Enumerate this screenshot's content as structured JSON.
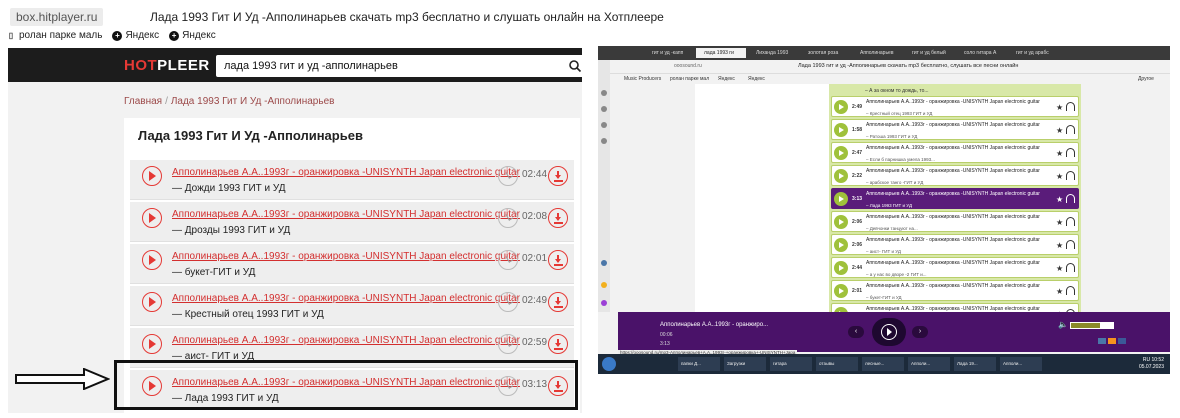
{
  "browser": {
    "url": "box.hitplayer.ru",
    "title": "Лада 1993 Гит И Уд -Апполинарьев скачать mp3 бесплатно и слушать онлайн на Хотплеере",
    "bookmarks": [
      "ролан парке маль",
      "Яндекс",
      "Яндекс"
    ]
  },
  "site": {
    "logo_a": "HOT",
    "logo_b": "PLEER",
    "search_value": "лада 1993 гит и уд -апполинарьев",
    "breadcrumb": [
      "Главная",
      "Лада 1993 Гит И Уд -Апполинарьев"
    ],
    "breadcrumb_sep": "/",
    "heading": "Лада 1993 Гит И Уд -Апполинарьев"
  },
  "tracks": [
    {
      "artist": "Апполинарьев А.А..1993г - оранжировка -UNISYNTH Japan electronic guitar",
      "song": "— Дожди 1993 ГИТ и УД",
      "duration": "02:44"
    },
    {
      "artist": "Апполинарьев А.А..1993г - оранжировка -UNISYNTH Japan electronic guitar",
      "song": "— Дрозды 1993 ГИТ и УД",
      "duration": "02:08"
    },
    {
      "artist": "Апполинарьев А.А..1993г - оранжировка -UNISYNTH Japan electronic guitar",
      "song": "— букет-ГИТ и УД",
      "duration": "02:01"
    },
    {
      "artist": "Апполинарьев А.А..1993г - оранжировка -UNISYNTH Japan electronic guitar",
      "song": "— Крестный отец 1993 ГИТ и УД",
      "duration": "02:49"
    },
    {
      "artist": "Апполинарьев А.А..1993г - оранжировка -UNISYNTH Japan electronic guitar",
      "song": "— аист- ГИТ и УД",
      "duration": "02:59"
    },
    {
      "artist": "Апполинарьев А.А..1993г - оранжировка -UNISYNTH Japan electronic guitar",
      "song": "— Лада 1993 ГИТ и УД",
      "duration": "03:13"
    }
  ],
  "screenshot2": {
    "tabs": [
      "гит и уд -капп",
      "лада 1993 ги",
      "Лиханда 1993",
      "золотая роза",
      "Апполинарьев",
      "гит и уд белый",
      "соло гитара А",
      "гит и уд арабс"
    ],
    "address": "ooosound.ru",
    "title": "Лада 1993 гит и уд -Апполинарьев скачать mp3 бесплатно, слушать все песни онлайн",
    "bookmarks": [
      "Music Producers",
      "ролан парке мал",
      "Яндекс",
      "Яндекс"
    ],
    "other_bookmarks": "Другое",
    "snippet": "– А за окном то дождь, то...",
    "items": [
      {
        "dur": "2:49",
        "t1": "Апполинарьев А.А..1993г - оранжировка -UNISYNTH Japan electronic guitar",
        "t2": "– Крестный отец 1993 ГИТ и УД"
      },
      {
        "dur": "1:58",
        "t1": "Апполинарьев А.А..1993г - оранжировка -UNISYNTH Japan electronic guitar",
        "t2": "– Ратоша 1993 ГИТ и УД"
      },
      {
        "dur": "2:47",
        "t1": "Апполинарьев А.А..1993г - оранжировка -UNISYNTH Japan electronic guitar",
        "t2": "– Если б парнишка умела 1993..."
      },
      {
        "dur": "2:22",
        "t1": "Апполинарьев А.А..1993г - оранжировка -UNISYNTH Japan electronic guitar",
        "t2": "– арабское танго -ГИТ и УД"
      },
      {
        "dur": "3:13",
        "t1": "Апполинарьев А.А..1993г - оранжировка -UNISYNTH Japan electronic guitar",
        "t2": "– Лада 1993 ГИТ и УД",
        "active": true
      },
      {
        "dur": "2:06",
        "t1": "Апполинарьев А.А..1993г - оранжировка -UNISYNTH Japan electronic guitar",
        "t2": "– Девчонки танцуют на..."
      },
      {
        "dur": "2:06",
        "t1": "Апполинарьев А.А..1993г - оранжировка -UNISYNTH Japan electronic guitar",
        "t2": "– аист- ГИТ и УД"
      },
      {
        "dur": "2:44",
        "t1": "Апполинарьев А.А..1993г - оранжировка -UNISYNTH Japan electronic guitar",
        "t2": "– а у нас во дворе -2 ГИТ и..."
      },
      {
        "dur": "2:01",
        "t1": "Апполинарьев А.А..1993г - оранжировка -UNISYNTH Japan electronic guitar",
        "t2": "– букет-ГИТ и УД"
      },
      {
        "dur": "",
        "t1": "Апполинарьев А.А..1993г - оранжировка -UNISYNTH Japan electronic guitar",
        "t2": ""
      }
    ],
    "player_title": "Апполинарьев А.А..1993г - оранжиро...",
    "player_l1": "00:06",
    "player_l2": "3:13",
    "volume_level": 0.7,
    "status_url": "https://ooosound.ru/mp3-Апполинарьев+А.А..1993г-+оранжировка+-UNISYNTH+Japa",
    "taskbar": [
      "папки Д...",
      "Загрузки",
      "гитара",
      "отзывы",
      "лесные...",
      "Апполи...",
      "Лада 19...",
      "Апполи..."
    ],
    "clock_time": "10:52",
    "clock_date": "05.07.2023",
    "lang": "RU"
  }
}
